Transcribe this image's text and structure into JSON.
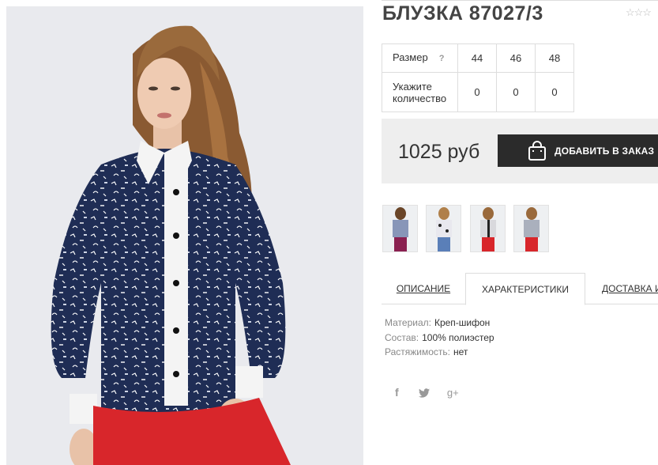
{
  "product": {
    "title": "БЛУЗКА 87027/3",
    "rating_stars": "☆☆☆"
  },
  "sizes_table": {
    "size_label": "Размер",
    "help_mark": "?",
    "sizes": [
      "44",
      "46",
      "48"
    ],
    "qty_label_line1": "Укажите",
    "qty_label_line2": "количество",
    "quantities": [
      "0",
      "0",
      "0"
    ]
  },
  "purchase": {
    "price": "1025 руб",
    "add_button": "ДОБАВИТЬ В ЗАКАЗ"
  },
  "tabs": [
    {
      "label": "ОПИСАНИЕ",
      "active": false
    },
    {
      "label": "ХАРАКТЕРИСТИКИ",
      "active": true
    },
    {
      "label": "ДОСТАВКА И О",
      "active": false
    }
  ],
  "characteristics": [
    {
      "key": "Материал:",
      "value": "Креп-шифон"
    },
    {
      "key": "Состав:",
      "value": "100% полиэстер"
    },
    {
      "key": "Растяжимость:",
      "value": "нет"
    }
  ],
  "social": {
    "facebook": "f",
    "twitter": "twitter-icon",
    "googleplus": "g+"
  },
  "colors": {
    "blouse_navy": "#1f2d55",
    "pants_red": "#d8262b",
    "button_dark": "#2b2b2b",
    "price_bg": "#eeeeee"
  }
}
